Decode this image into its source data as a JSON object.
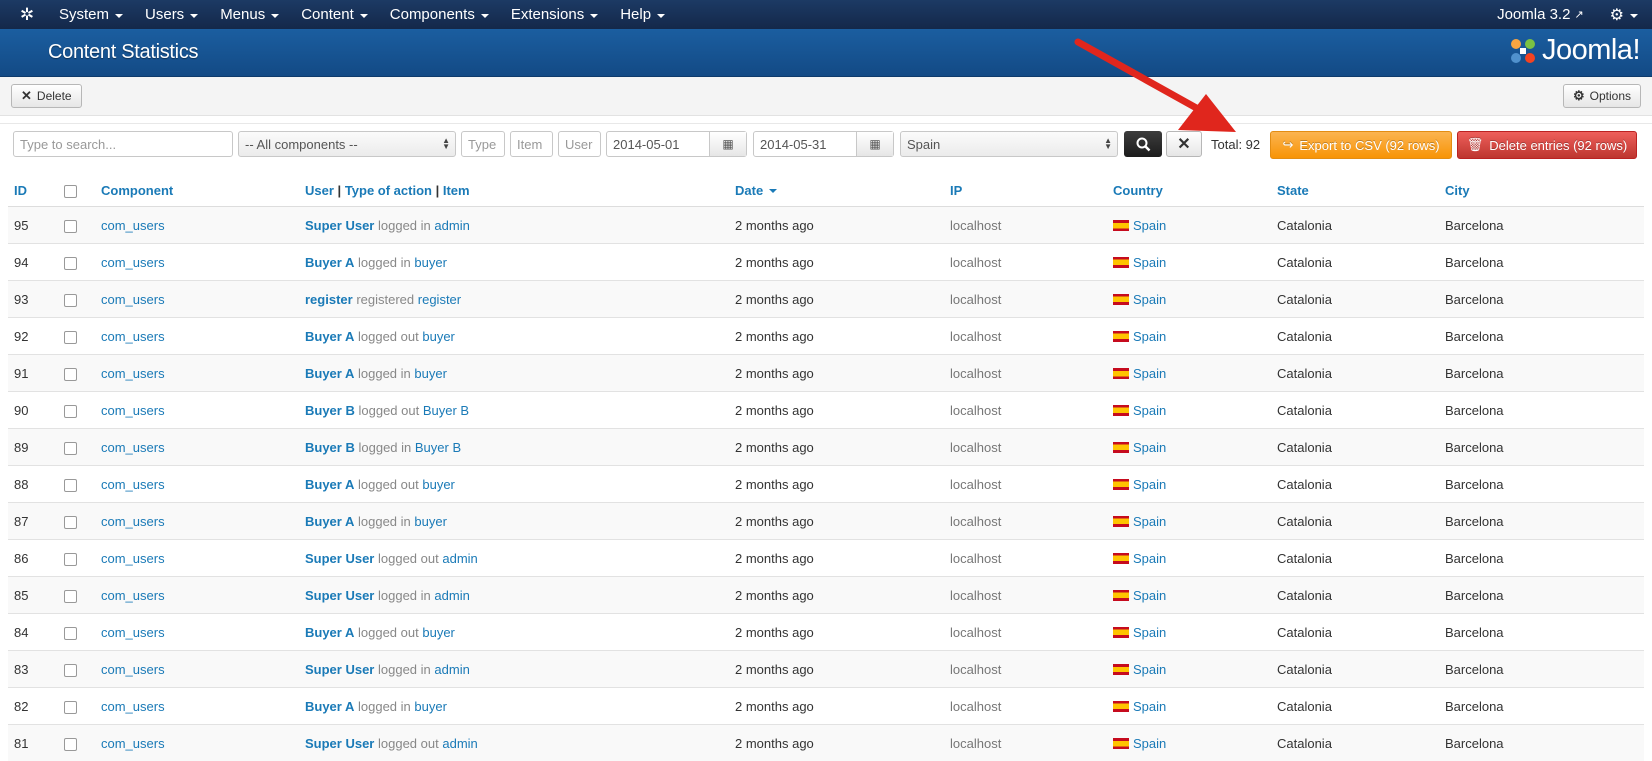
{
  "topbar": {
    "menu": [
      "System",
      "Users",
      "Menus",
      "Content",
      "Components",
      "Extensions",
      "Help"
    ],
    "version": "Joomla 3.2"
  },
  "header": {
    "title": "Content Statistics",
    "logo_text": "Joomla!"
  },
  "toolbar": {
    "delete_label": "Delete",
    "options_label": "Options"
  },
  "filters": {
    "search_placeholder": "Type to search...",
    "component_selected": "-- All components --",
    "type_placeholder": "Type",
    "item_placeholder": "Item",
    "user_placeholder": "User",
    "date_from": "2014-05-01",
    "date_to": "2014-05-31",
    "country_selected": "Spain",
    "total": "Total: 92",
    "export_label": "Export to CSV (92 rows)",
    "delete_entries_label": "Delete entries (92 rows)"
  },
  "table": {
    "headers": {
      "id": "ID",
      "component": "Component",
      "user": "User",
      "sep": "|",
      "type": "Type of action",
      "item": "Item",
      "date": "Date",
      "ip": "IP",
      "country": "Country",
      "state": "State",
      "city": "City"
    },
    "rows": [
      {
        "id": "95",
        "component": "com_users",
        "user": "Super User",
        "action": "logged in",
        "item": "admin",
        "date": "2 months ago",
        "ip": "localhost",
        "country": "Spain",
        "state": "Catalonia",
        "city": "Barcelona"
      },
      {
        "id": "94",
        "component": "com_users",
        "user": "Buyer A",
        "action": "logged in",
        "item": "buyer",
        "date": "2 months ago",
        "ip": "localhost",
        "country": "Spain",
        "state": "Catalonia",
        "city": "Barcelona"
      },
      {
        "id": "93",
        "component": "com_users",
        "user": "register",
        "action": "registered",
        "item": "register",
        "date": "2 months ago",
        "ip": "localhost",
        "country": "Spain",
        "state": "Catalonia",
        "city": "Barcelona"
      },
      {
        "id": "92",
        "component": "com_users",
        "user": "Buyer A",
        "action": "logged out",
        "item": "buyer",
        "date": "2 months ago",
        "ip": "localhost",
        "country": "Spain",
        "state": "Catalonia",
        "city": "Barcelona"
      },
      {
        "id": "91",
        "component": "com_users",
        "user": "Buyer A",
        "action": "logged in",
        "item": "buyer",
        "date": "2 months ago",
        "ip": "localhost",
        "country": "Spain",
        "state": "Catalonia",
        "city": "Barcelona"
      },
      {
        "id": "90",
        "component": "com_users",
        "user": "Buyer B",
        "action": "logged out",
        "item": "Buyer B",
        "date": "2 months ago",
        "ip": "localhost",
        "country": "Spain",
        "state": "Catalonia",
        "city": "Barcelona"
      },
      {
        "id": "89",
        "component": "com_users",
        "user": "Buyer B",
        "action": "logged in",
        "item": "Buyer B",
        "date": "2 months ago",
        "ip": "localhost",
        "country": "Spain",
        "state": "Catalonia",
        "city": "Barcelona"
      },
      {
        "id": "88",
        "component": "com_users",
        "user": "Buyer A",
        "action": "logged out",
        "item": "buyer",
        "date": "2 months ago",
        "ip": "localhost",
        "country": "Spain",
        "state": "Catalonia",
        "city": "Barcelona"
      },
      {
        "id": "87",
        "component": "com_users",
        "user": "Buyer A",
        "action": "logged in",
        "item": "buyer",
        "date": "2 months ago",
        "ip": "localhost",
        "country": "Spain",
        "state": "Catalonia",
        "city": "Barcelona"
      },
      {
        "id": "86",
        "component": "com_users",
        "user": "Super User",
        "action": "logged out",
        "item": "admin",
        "date": "2 months ago",
        "ip": "localhost",
        "country": "Spain",
        "state": "Catalonia",
        "city": "Barcelona"
      },
      {
        "id": "85",
        "component": "com_users",
        "user": "Super User",
        "action": "logged in",
        "item": "admin",
        "date": "2 months ago",
        "ip": "localhost",
        "country": "Spain",
        "state": "Catalonia",
        "city": "Barcelona"
      },
      {
        "id": "84",
        "component": "com_users",
        "user": "Buyer A",
        "action": "logged out",
        "item": "buyer",
        "date": "2 months ago",
        "ip": "localhost",
        "country": "Spain",
        "state": "Catalonia",
        "city": "Barcelona"
      },
      {
        "id": "83",
        "component": "com_users",
        "user": "Super User",
        "action": "logged in",
        "item": "admin",
        "date": "2 months ago",
        "ip": "localhost",
        "country": "Spain",
        "state": "Catalonia",
        "city": "Barcelona"
      },
      {
        "id": "82",
        "component": "com_users",
        "user": "Buyer A",
        "action": "logged in",
        "item": "buyer",
        "date": "2 months ago",
        "ip": "localhost",
        "country": "Spain",
        "state": "Catalonia",
        "city": "Barcelona"
      },
      {
        "id": "81",
        "component": "com_users",
        "user": "Super User",
        "action": "logged out",
        "item": "admin",
        "date": "2 months ago",
        "ip": "localhost",
        "country": "Spain",
        "state": "Catalonia",
        "city": "Barcelona"
      }
    ]
  },
  "icons": {
    "joomla": "joomla-icon",
    "external": "external-link-icon",
    "gear": "gear-icon",
    "calendar": "calendar-icon",
    "search": "search-icon",
    "clear": "close-icon",
    "export": "share-icon",
    "trash": "trash-icon",
    "flag": "spain-flag-icon"
  },
  "colors": {
    "topbar": "#17304f",
    "header": "#165a9c",
    "link": "#1a7ab7",
    "export": "#f89406",
    "delete": "#c8352f",
    "arrow": "#e0261d"
  }
}
